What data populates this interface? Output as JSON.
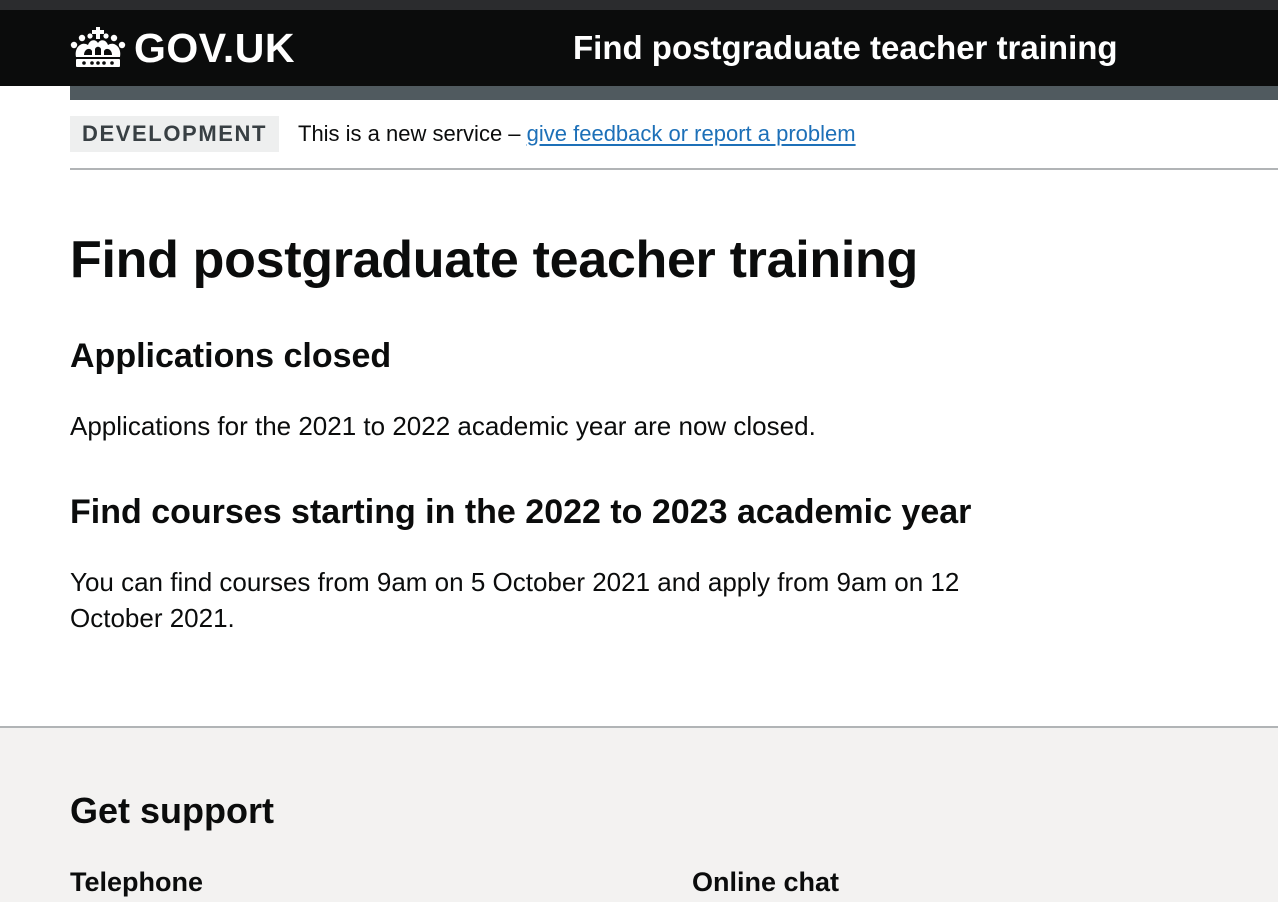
{
  "header": {
    "logo_text": "GOV.UK",
    "logo_icon": "crown-icon",
    "service_name": "Find postgraduate teacher training",
    "background": "#0b0c0c"
  },
  "phase_banner": {
    "tag": "DEVELOPMENT",
    "text": "This is a new service – ",
    "link_text": "give feedback or report a problem",
    "link_color": "#1d70b8"
  },
  "main": {
    "title": "Find postgraduate teacher training",
    "section1": {
      "heading": "Applications closed",
      "body": "Applications for the 2021 to 2022 academic year are now closed."
    },
    "section2": {
      "heading": "Find courses starting in the 2022 to 2023 academic year",
      "body": "You can find courses from 9am on 5 October 2021 and apply from 9am on 12 October 2021."
    }
  },
  "footer": {
    "heading": "Get support",
    "telephone_title": "Telephone",
    "chat_title": "Online chat",
    "background": "#f3f2f1"
  }
}
